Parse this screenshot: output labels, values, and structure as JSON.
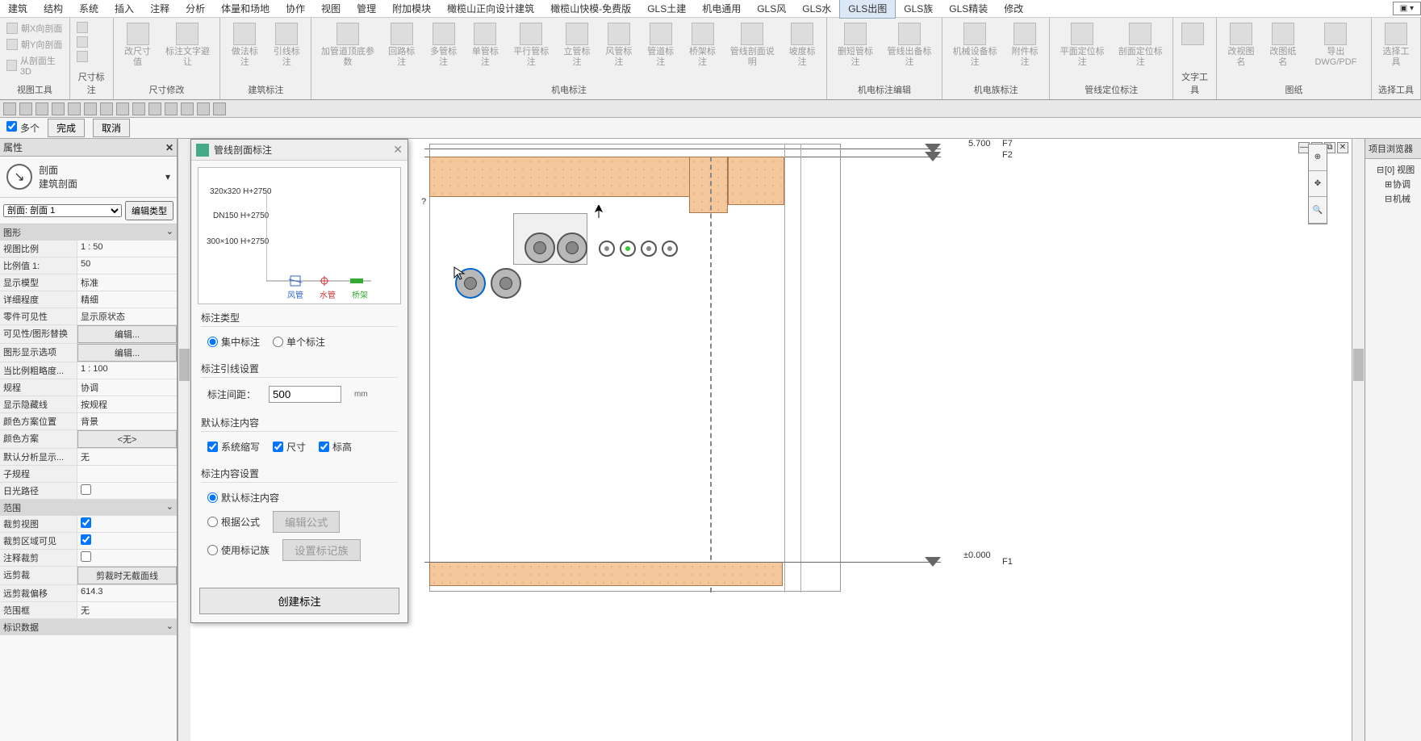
{
  "menubar": {
    "items": [
      "建筑",
      "结构",
      "系统",
      "插入",
      "注释",
      "分析",
      "体量和场地",
      "协作",
      "视图",
      "管理",
      "附加模块",
      "橄榄山正向设计建筑",
      "橄榄山快模-免费版",
      "GLS土建",
      "机电通用",
      "GLS风",
      "GLS水",
      "GLS出图",
      "GLS族",
      "GLS精装",
      "修改"
    ],
    "active_index": 17,
    "expand": "▣ ▾"
  },
  "ribbon": {
    "groups": [
      {
        "label": "视图工具",
        "items_sm": [
          "朝X向剖面",
          "朝Y向剖面",
          "从剖面生3D"
        ]
      },
      {
        "label": "尺寸标注",
        "items_sm": [
          "",
          "",
          ""
        ]
      },
      {
        "label": "尺寸修改",
        "items": [
          "改尺寸值",
          "标注文字避让"
        ]
      },
      {
        "label": "建筑标注",
        "items": [
          "做法标注",
          "引线标注"
        ]
      },
      {
        "label": "机电标注",
        "items": [
          "加管道顶底参数",
          "回路标注",
          "多管标注",
          "单管标注",
          "平行管标注",
          "立管标注",
          "风管标注",
          "管道标注",
          "桥架标注",
          "管线剖面说明",
          "坡度标注"
        ]
      },
      {
        "label": "机电标注编辑",
        "items": [
          "删短管标注",
          "管线出备标注"
        ]
      },
      {
        "label": "机电族标注",
        "items": [
          "机械设备标注",
          "附件标注"
        ]
      },
      {
        "label": "管线定位标注",
        "items": [
          "平面定位标注",
          "剖面定位标注"
        ]
      },
      {
        "label": "文字工具",
        "items": [
          ""
        ]
      },
      {
        "label": "图纸",
        "items": [
          "改视图名",
          "改图纸名",
          "导出DWG/PDF"
        ]
      },
      {
        "label": "选择工具",
        "items": [
          "选择工具"
        ]
      }
    ]
  },
  "optbar": {
    "multiple_label": "多个",
    "finish": "完成",
    "cancel": "取消"
  },
  "props": {
    "title": "属性",
    "type_cat": "剖面",
    "type_name": "建筑剖面",
    "instance": "剖面: 剖面 1",
    "edit_type": "编辑类型",
    "sections": [
      {
        "title": "图形",
        "rows": [
          {
            "k": "视图比例",
            "v": "1 : 50"
          },
          {
            "k": "比例值 1:",
            "v": "50"
          },
          {
            "k": "显示模型",
            "v": "标准"
          },
          {
            "k": "详细程度",
            "v": "精细"
          },
          {
            "k": "零件可见性",
            "v": "显示原状态"
          },
          {
            "k": "可见性/图形替换",
            "v": "编辑...",
            "btn": true
          },
          {
            "k": "图形显示选项",
            "v": "编辑...",
            "btn": true
          },
          {
            "k": "当比例粗略度...",
            "v": "1 : 100"
          },
          {
            "k": "规程",
            "v": "协调"
          },
          {
            "k": "显示隐藏线",
            "v": "按规程"
          },
          {
            "k": "颜色方案位置",
            "v": "背景"
          },
          {
            "k": "颜色方案",
            "v": "<无>",
            "btn": true
          },
          {
            "k": "默认分析显示...",
            "v": "无"
          },
          {
            "k": "子规程",
            "v": ""
          },
          {
            "k": "日光路径",
            "v": "",
            "chk": true
          }
        ]
      },
      {
        "title": "范围",
        "rows": [
          {
            "k": "裁剪视图",
            "v": "",
            "chk": true,
            "checked": true
          },
          {
            "k": "裁剪区域可见",
            "v": "",
            "chk": true,
            "checked": true
          },
          {
            "k": "注释裁剪",
            "v": "",
            "chk": true
          },
          {
            "k": "远剪裁",
            "v": "剪裁时无截面线",
            "btn": true
          },
          {
            "k": "远剪裁偏移",
            "v": "614.3"
          },
          {
            "k": "范围框",
            "v": "无"
          }
        ]
      },
      {
        "title": "标识数据",
        "rows": []
      }
    ]
  },
  "dialog": {
    "title": "管线剖面标注",
    "preview_lines": [
      "320x320 H+2750",
      "DN150 H+2750",
      "300×100 H+2750"
    ],
    "preview_legend": [
      "风管",
      "水管",
      "桥架"
    ],
    "group1_title": "标注类型",
    "radio_concentrated": "集中标注",
    "radio_single": "单个标注",
    "group2_title": "标注引线设置",
    "spacing_label": "标注间距：",
    "spacing_value": "500",
    "spacing_unit": "mm",
    "group3_title": "默认标注内容",
    "chk_sys": "系统缩写",
    "chk_size": "尺寸",
    "chk_elev": "标高",
    "group4_title": "标注内容设置",
    "radio_default": "默认标注内容",
    "radio_formula": "根据公式",
    "btn_formula": "编辑公式",
    "radio_tagfam": "使用标记族",
    "btn_tagfam": "设置标记族",
    "create_btn": "创建标注"
  },
  "canvas": {
    "level_top_elev": "5.700",
    "level_top_name_1": "F7",
    "level_top_name_2": "F2",
    "level_bot_elev": "±0.000",
    "level_bot_name": "F1",
    "view_question": "?"
  },
  "browser": {
    "title": "项目浏览器",
    "items": [
      "[0] 视图",
      "协调",
      "机械"
    ]
  }
}
